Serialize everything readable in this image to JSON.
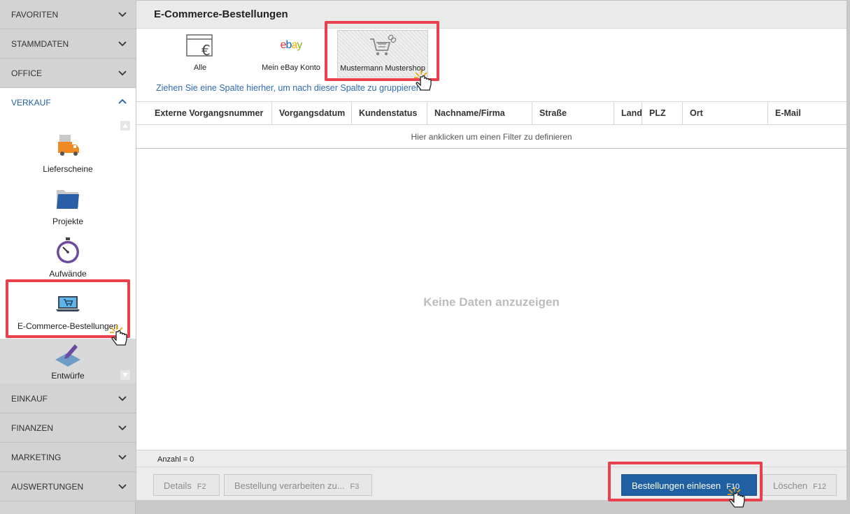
{
  "sidebar": {
    "sections": {
      "favoriten": "FAVORITEN",
      "stammdaten": "STAMMDATEN",
      "office": "OFFICE",
      "verkauf": "VERKAUF",
      "einkauf": "EINKAUF",
      "finanzen": "FINANZEN",
      "marketing": "MARKETING",
      "auswertungen": "AUSWERTUNGEN"
    },
    "items": {
      "lieferscheine": "Lieferscheine",
      "projekte": "Projekte",
      "aufwaende": "Aufwände",
      "ecommerce": "E-Commerce-Bestellungen",
      "entwuerfe": "Entwürfe"
    }
  },
  "main": {
    "title": "E-Commerce-Bestellungen",
    "shops": {
      "alle": "Alle",
      "ebay": "Mein eBay Konto",
      "mustermann": "Mustermann Mustershop"
    },
    "ebay_logo_text": "ebay",
    "group_hint": "Ziehen Sie eine Spalte hierher, um nach dieser Spalte zu gruppieren",
    "columns": {
      "ext": "Externe Vorgangsnummer",
      "datum": "Vorgangsdatum",
      "status": "Kundenstatus",
      "name": "Nachname/Firma",
      "strasse": "Straße",
      "land": "Land",
      "plz": "PLZ",
      "ort": "Ort",
      "email": "E-Mail"
    },
    "filter_hint": "Hier anklicken um einen Filter zu definieren",
    "empty_text": "Keine Daten anzuzeigen",
    "count_label": "Anzahl = 0"
  },
  "footer": {
    "details": {
      "label": "Details",
      "key": "F2"
    },
    "verarbeiten": {
      "label": "Bestellung verarbeiten zu...",
      "key": "F3"
    },
    "einlesen": {
      "label": "Bestellungen einlesen",
      "key": "F10"
    },
    "loeschen": {
      "label": "Löschen",
      "key": "F12"
    }
  },
  "colors": {
    "accent": "#1f5fa2",
    "highlight": "#e9404d",
    "link": "#2f6ab3"
  },
  "icons": {
    "expand": "chevron-down-icon",
    "collapse": "chevron-up-icon",
    "cursor": "hand-pointer-icon"
  }
}
